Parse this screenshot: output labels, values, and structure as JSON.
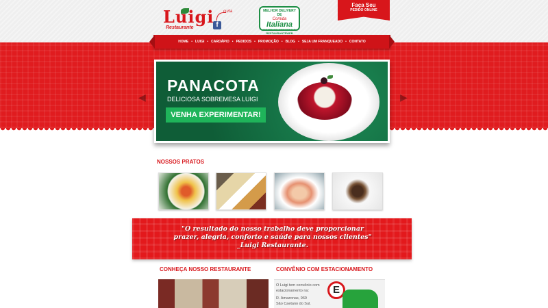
{
  "header": {
    "logo_text": "Luigi",
    "logo_sub": "Restaurante",
    "facebook": "f",
    "curta": "curta",
    "badge": {
      "top": "MELHOR DELIVERY DE",
      "script": "Comida",
      "main": "Italiana",
      "bottom": "DO BRASIL SEGUNDO O RESTAURANTEWEB"
    },
    "order": {
      "title": "Faça Seu",
      "sub": "PEDIDO ONLINE"
    }
  },
  "nav": {
    "items": [
      "HOME",
      "LUIGI",
      "CARDÁPIO",
      "PEDIDOS",
      "PROMOÇÃO",
      "BLOG",
      "SEJA UM FRANQUEADO",
      "CONTATO"
    ]
  },
  "slider": {
    "title": "PANACOTA",
    "subtitle": "DELICIOSA SOBREMESA LUIGI",
    "cta": "VENHA EXPERIMENTAR!"
  },
  "dishes": {
    "title": "NOSSOS PRATOS"
  },
  "quote": {
    "line1": "\"O resultado do nosso trabalho deve proporcionar",
    "line2": "prazer, alegria, conforto e saúde para nossos clientes\"",
    "line3": "_Luigi Restaurante."
  },
  "sections": {
    "restaurant_title": "CONHEÇA NOSSO RESTAURANTE",
    "parking_title": "CONVÊNIO COM ESTACIONAMENTO",
    "parking_line1": "O Luigi tem convênio com",
    "parking_line2": "estacionamento na:",
    "parking_line3": "R. Amazonas, 969",
    "parking_line4": "São Caetano do Sul.",
    "parking_sign": "E"
  },
  "colors": {
    "accent_red": "#d8161b",
    "green": "#127043"
  }
}
